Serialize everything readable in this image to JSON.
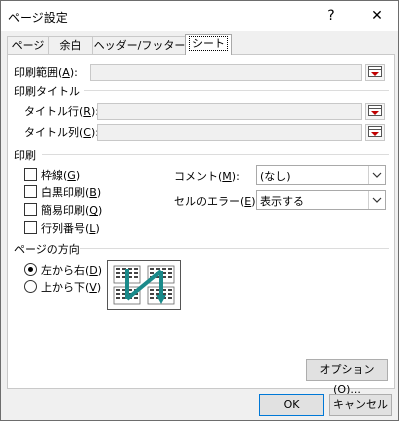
{
  "window": {
    "title": "ページ設定",
    "help_glyph": "?",
    "close_glyph": "✕"
  },
  "tabs": [
    {
      "label": "ページ"
    },
    {
      "label": "余白"
    },
    {
      "label": "ヘッダー/フッター"
    },
    {
      "label": "シート"
    }
  ],
  "print_area": {
    "label": "印刷範囲(",
    "key": "A",
    "suffix": "):"
  },
  "print_titles": {
    "heading": "印刷タイトル",
    "rows": {
      "label": "タイトル行(",
      "key": "R",
      "suffix": "):"
    },
    "cols": {
      "label": "タイトル列(",
      "key": "C",
      "suffix": "):"
    }
  },
  "print": {
    "heading": "印刷",
    "gridlines": {
      "label": "枠線(",
      "key": "G",
      "suffix": ")"
    },
    "black_white": {
      "label": "白黒印刷(",
      "key": "B",
      "suffix": ")"
    },
    "draft": {
      "label": "簡易印刷(",
      "key": "Q",
      "suffix": ")"
    },
    "headings": {
      "label": "行列番号(",
      "key": "L",
      "suffix": ")"
    },
    "comments": {
      "label": "コメント(",
      "key": "M",
      "suffix": "):",
      "value": "(なし)"
    },
    "cell_errors": {
      "label": "セルのエラー(",
      "key": "E",
      "suffix": "):",
      "value": "表示する"
    }
  },
  "page_order": {
    "heading": "ページの方向",
    "down_over": {
      "label": "左から右(",
      "key": "D",
      "suffix": ")",
      "selected": true
    },
    "over_down": {
      "label": "上から下(",
      "key": "V",
      "suffix": ")",
      "selected": false
    }
  },
  "buttons": {
    "options": "オプション(O)...",
    "ok": "OK",
    "cancel": "キャンセル"
  },
  "colors": {
    "accent": "#0078d7",
    "arrow": "#1a8a8a"
  }
}
